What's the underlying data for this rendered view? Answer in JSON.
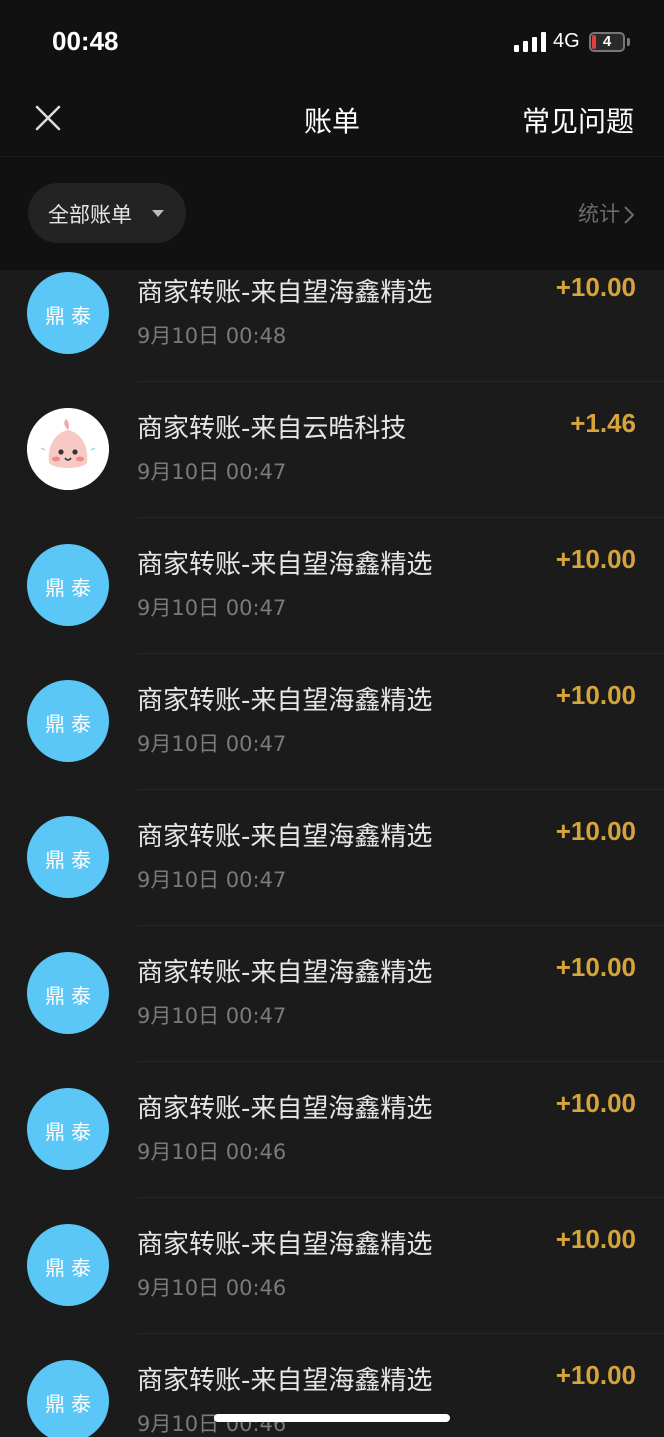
{
  "status": {
    "time": "00:48",
    "network": "4G",
    "battery": "4"
  },
  "nav": {
    "title": "账单",
    "faq": "常见问题"
  },
  "filter": {
    "label": "全部账单",
    "stats": "统计"
  },
  "colors": {
    "amount": "#d6a43a",
    "avatar": "#5bc7f7",
    "background": "#1b1b1b"
  },
  "transactions": [
    {
      "title": "商家转账-来自望海鑫精选",
      "date": "9月10日 00:48",
      "amount": "+10.00",
      "avatar_text": "鼎泰"
    },
    {
      "title": "商家转账-来自云晧科技",
      "date": "9月10日 00:47",
      "amount": "+1.46",
      "avatar_icon": "peach-avatar"
    },
    {
      "title": "商家转账-来自望海鑫精选",
      "date": "9月10日 00:47",
      "amount": "+10.00",
      "avatar_text": "鼎泰"
    },
    {
      "title": "商家转账-来自望海鑫精选",
      "date": "9月10日 00:47",
      "amount": "+10.00",
      "avatar_text": "鼎泰"
    },
    {
      "title": "商家转账-来自望海鑫精选",
      "date": "9月10日 00:47",
      "amount": "+10.00",
      "avatar_text": "鼎泰"
    },
    {
      "title": "商家转账-来自望海鑫精选",
      "date": "9月10日 00:47",
      "amount": "+10.00",
      "avatar_text": "鼎泰"
    },
    {
      "title": "商家转账-来自望海鑫精选",
      "date": "9月10日 00:46",
      "amount": "+10.00",
      "avatar_text": "鼎泰"
    },
    {
      "title": "商家转账-来自望海鑫精选",
      "date": "9月10日 00:46",
      "amount": "+10.00",
      "avatar_text": "鼎泰"
    },
    {
      "title": "商家转账-来自望海鑫精选",
      "date": "9月10日 00:46",
      "amount": "+10.00",
      "avatar_text": "鼎泰"
    }
  ]
}
